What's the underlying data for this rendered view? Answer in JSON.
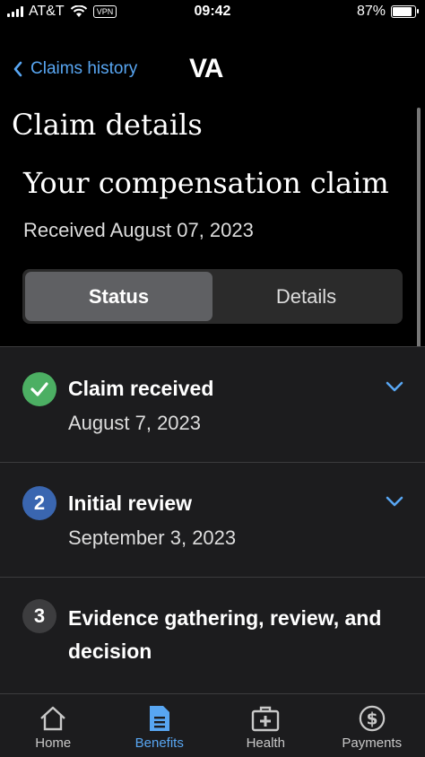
{
  "status_bar": {
    "carrier": "AT&T",
    "vpn": "VPN",
    "time": "09:42",
    "battery_text": "87%",
    "battery_level": 0.87
  },
  "nav": {
    "back_label": "Claims history",
    "logo": "VA"
  },
  "page": {
    "title": "Claim details",
    "claim_title": "Your compensation claim",
    "received": "Received August 07, 2023"
  },
  "segments": [
    {
      "label": "Status",
      "active": true
    },
    {
      "label": "Details",
      "active": false
    }
  ],
  "steps": [
    {
      "number": "",
      "icon": "check-icon",
      "title": "Claim received",
      "date": "August 7, 2023",
      "color": "#4caf63"
    },
    {
      "number": "2",
      "icon": "step-number",
      "title": "Initial review",
      "date": "September 3, 2023",
      "color": "#3a66b0"
    },
    {
      "number": "3",
      "icon": "step-number",
      "title": "Evidence gathering, review, and decision",
      "date": "",
      "color": "#3d3d3f"
    }
  ],
  "tabs": [
    {
      "label": "Home",
      "icon": "home-icon",
      "active": false
    },
    {
      "label": "Benefits",
      "icon": "document-icon",
      "active": true
    },
    {
      "label": "Health",
      "icon": "medical-kit-icon",
      "active": false
    },
    {
      "label": "Payments",
      "icon": "dollar-icon",
      "active": false
    }
  ],
  "colors": {
    "accent": "#58a6f2",
    "background": "#000000",
    "surface": "#1c1c1e"
  }
}
